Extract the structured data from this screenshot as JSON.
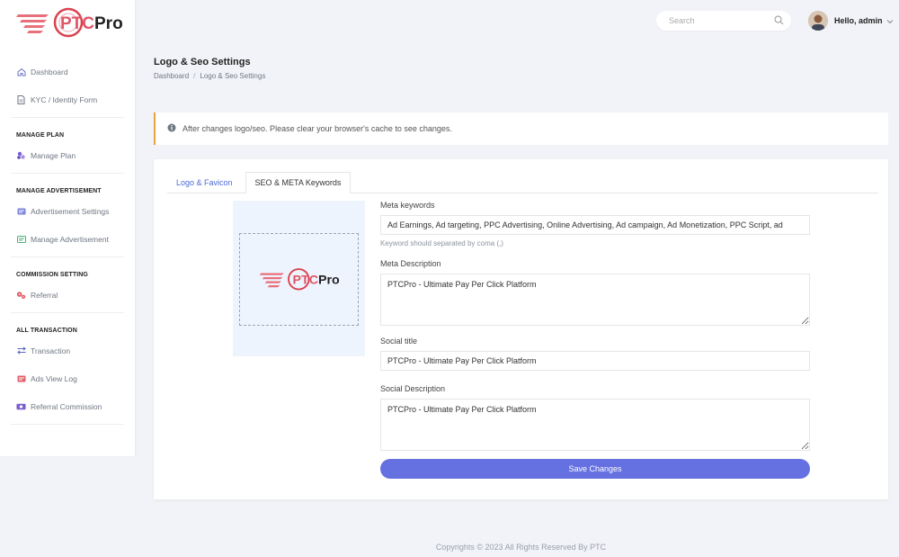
{
  "brand": {
    "name_prefix": "PTC",
    "name_suffix": "Pro",
    "accent": "#e05668",
    "logo_outline": "#d9434f"
  },
  "sidebar": {
    "items_top": [
      {
        "label": "Dashboard",
        "icon": "home-icon"
      },
      {
        "label": "KYC / Identity Form",
        "icon": "document-icon"
      }
    ],
    "sections": [
      {
        "heading": "MANAGE PLAN",
        "items": [
          {
            "label": "Manage Plan",
            "icon": "layers-icon"
          }
        ]
      },
      {
        "heading": "MANAGE ADVERTISEMENT",
        "items": [
          {
            "label": "Advertisement Settings",
            "icon": "ad-icon"
          },
          {
            "label": "Manage Advertisement",
            "icon": "ad-green-icon"
          }
        ]
      },
      {
        "heading": "COMMISSION SETTING",
        "items": [
          {
            "label": "Referral",
            "icon": "gears-icon"
          }
        ]
      },
      {
        "heading": "ALL TRANSACTION",
        "items": [
          {
            "label": "Transaction",
            "icon": "arrows-icon"
          },
          {
            "label": "Ads View Log",
            "icon": "ad-red-icon"
          },
          {
            "label": "Referral Commission",
            "icon": "money-icon"
          }
        ]
      }
    ]
  },
  "header": {
    "search_placeholder": "Search",
    "greeting": "Hello, admin"
  },
  "page": {
    "title": "Logo & Seo Settings",
    "breadcrumb": [
      "Dashboard",
      "Logo & Seo Settings"
    ]
  },
  "alert": {
    "text": "After changes logo/seo. Please clear your browser's cache to see changes."
  },
  "tabs": [
    {
      "label": "Logo & Favicon"
    },
    {
      "label": "SEO & META Keywords"
    }
  ],
  "form": {
    "meta_keywords": {
      "label": "Meta keywords",
      "value": "Ad Earnings, Ad targeting, PPC Advertising, Online Advertising, Ad campaign, Ad Monetization, PPC Script, ad",
      "help": "Keyword should separated by coma (,)"
    },
    "meta_description": {
      "label": "Meta Description",
      "value": "PTCPro - Ultimate Pay Per Click Platform"
    },
    "social_title": {
      "label": "Social title",
      "value": "PTCPro - Ultimate Pay Per Click Platform"
    },
    "social_description": {
      "label": "Social Description",
      "value": "PTCPro - Ultimate Pay Per Click Platform"
    },
    "save_label": "Save Changes"
  },
  "footer": {
    "text": "Copyrights © 2023 All Rights Reserved By PTC"
  }
}
